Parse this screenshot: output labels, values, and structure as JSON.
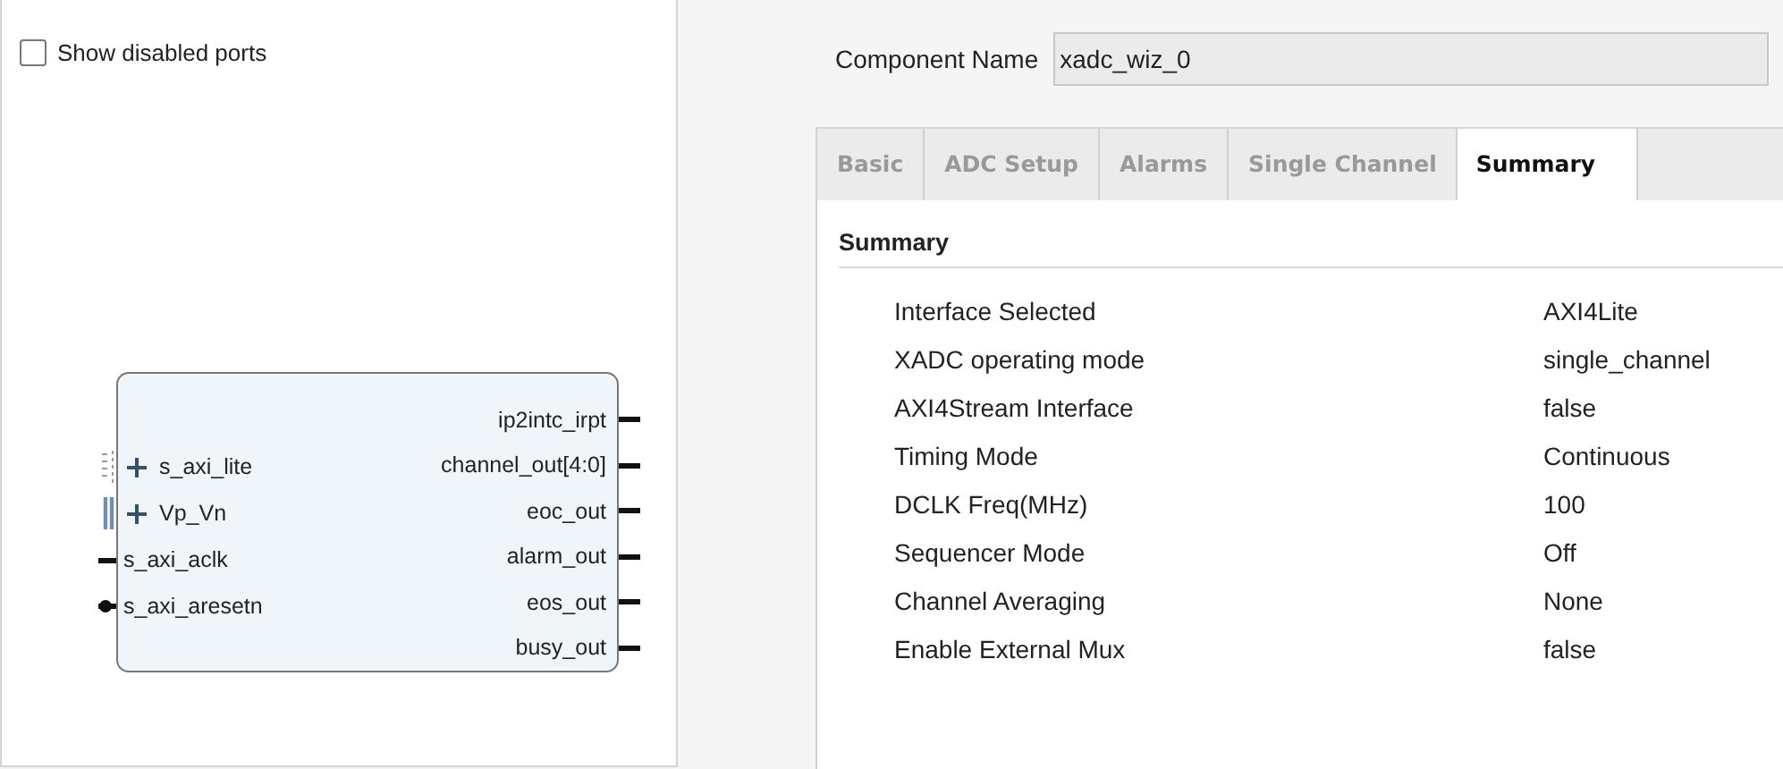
{
  "show_disabled_ports": {
    "label": "Show disabled ports",
    "checked": false
  },
  "block": {
    "inputs": [
      {
        "name": "s_axi_lite",
        "kind": "bus"
      },
      {
        "name": "Vp_Vn",
        "kind": "analog"
      },
      {
        "name": "s_axi_aclk",
        "kind": "wire"
      },
      {
        "name": "s_axi_aresetn",
        "kind": "reset"
      }
    ],
    "outputs": [
      "ip2intc_irpt",
      "channel_out[4:0]",
      "eoc_out",
      "alarm_out",
      "eos_out",
      "busy_out"
    ]
  },
  "component_name": {
    "label": "Component Name",
    "value": "xadc_wiz_0"
  },
  "tabs": [
    {
      "label": "Basic",
      "selected": false
    },
    {
      "label": "ADC Setup",
      "selected": false
    },
    {
      "label": "Alarms",
      "selected": false
    },
    {
      "label": "Single Channel",
      "selected": false
    },
    {
      "label": "Summary",
      "selected": true
    }
  ],
  "summary": {
    "title": "Summary",
    "rows": [
      {
        "label": "Interface Selected",
        "value": "AXI4Lite"
      },
      {
        "label": "XADC operating mode",
        "value": "single_channel"
      },
      {
        "label": "AXI4Stream Interface",
        "value": "false"
      },
      {
        "label": "Timing Mode",
        "value": "Continuous"
      },
      {
        "label": "DCLK Freq(MHz)",
        "value": "100"
      },
      {
        "label": "Sequencer Mode",
        "value": "Off"
      },
      {
        "label": "Channel Averaging",
        "value": "None"
      },
      {
        "label": "Enable External Mux",
        "value": "false"
      }
    ]
  }
}
